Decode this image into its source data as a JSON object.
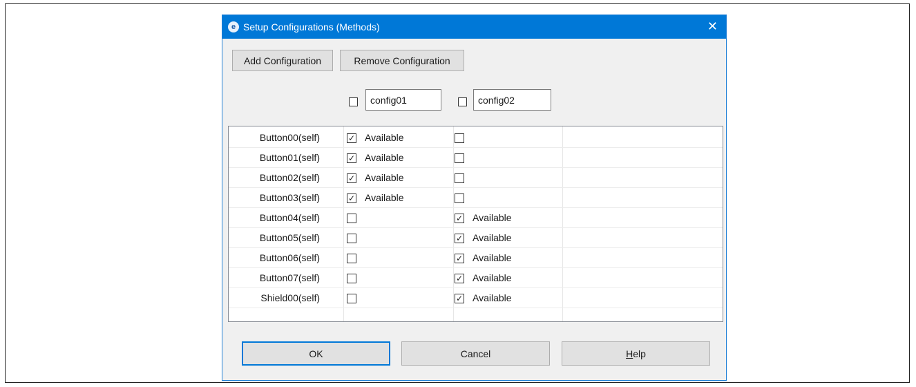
{
  "window": {
    "title": "Setup Configurations (Methods)",
    "app_icon_glyph": "e",
    "close_glyph": "✕"
  },
  "toolbar": {
    "add_label": "Add Configuration",
    "remove_label": "Remove Configuration"
  },
  "configs": [
    {
      "name": "config01",
      "checked": false
    },
    {
      "name": "config02",
      "checked": false
    }
  ],
  "rows": [
    {
      "label": "Button00(self)",
      "c1": true,
      "c1_text": "Available",
      "c2": false,
      "c2_text": ""
    },
    {
      "label": "Button01(self)",
      "c1": true,
      "c1_text": "Available",
      "c2": false,
      "c2_text": ""
    },
    {
      "label": "Button02(self)",
      "c1": true,
      "c1_text": "Available",
      "c2": false,
      "c2_text": ""
    },
    {
      "label": "Button03(self)",
      "c1": true,
      "c1_text": "Available",
      "c2": false,
      "c2_text": ""
    },
    {
      "label": "Button04(self)",
      "c1": false,
      "c1_text": "",
      "c2": true,
      "c2_text": "Available"
    },
    {
      "label": "Button05(self)",
      "c1": false,
      "c1_text": "",
      "c2": true,
      "c2_text": "Available"
    },
    {
      "label": "Button06(self)",
      "c1": false,
      "c1_text": "",
      "c2": true,
      "c2_text": "Available"
    },
    {
      "label": "Button07(self)",
      "c1": false,
      "c1_text": "",
      "c2": true,
      "c2_text": "Available"
    },
    {
      "label": "Shield00(self)",
      "c1": false,
      "c1_text": "",
      "c2": true,
      "c2_text": "Available"
    }
  ],
  "footer": {
    "ok_label": "OK",
    "cancel_label": "Cancel",
    "help_label_mnemonic": "H",
    "help_label_rest": "elp"
  },
  "colors": {
    "titlebar": "#0078d7",
    "dialog_bg": "#f0f0f0",
    "button_bg": "#e1e1e1"
  }
}
